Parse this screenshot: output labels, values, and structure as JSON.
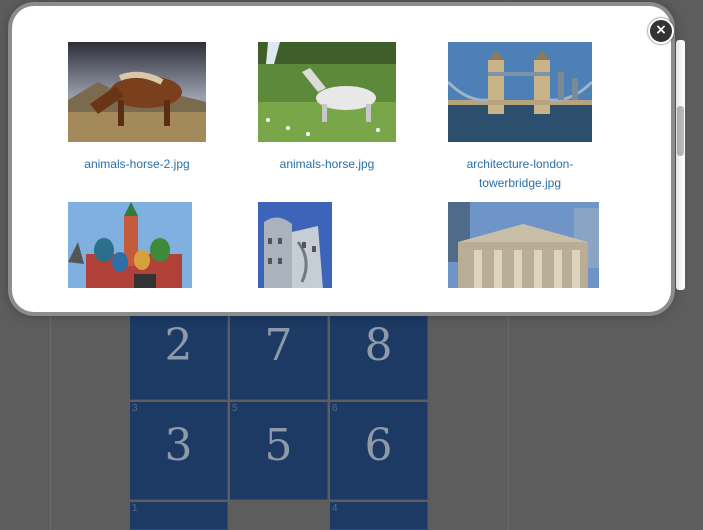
{
  "background": {
    "tiles": [
      {
        "label": "2",
        "small": ""
      },
      {
        "label": "7",
        "small": ""
      },
      {
        "label": "8",
        "small": ""
      },
      {
        "label": "3",
        "small": "3"
      },
      {
        "label": "5",
        "small": "5"
      },
      {
        "label": "6",
        "small": "6"
      },
      {
        "label": "",
        "small": "1"
      },
      {
        "label": "",
        "small": "4"
      }
    ]
  },
  "modal": {
    "close_icon": "×",
    "images": [
      {
        "file": "animals-horse-2.jpg",
        "line1": "animals-horse-2.jpg",
        "line2": ""
      },
      {
        "file": "animals-horse.jpg",
        "line1": "animals-horse.jpg",
        "line2": ""
      },
      {
        "file": "architecture-london-towerbridge.jpg",
        "line1": "architecture-london-",
        "line2": "towerbridge.jpg"
      },
      {
        "file": "",
        "line1": "",
        "line2": ""
      },
      {
        "file": "",
        "line1": "",
        "line2": ""
      },
      {
        "file": "",
        "line1": "",
        "line2": ""
      }
    ]
  },
  "colors": {
    "tile": "#1c3a63",
    "link": "#2a6fa8",
    "overlay": "#5d5d5d"
  }
}
